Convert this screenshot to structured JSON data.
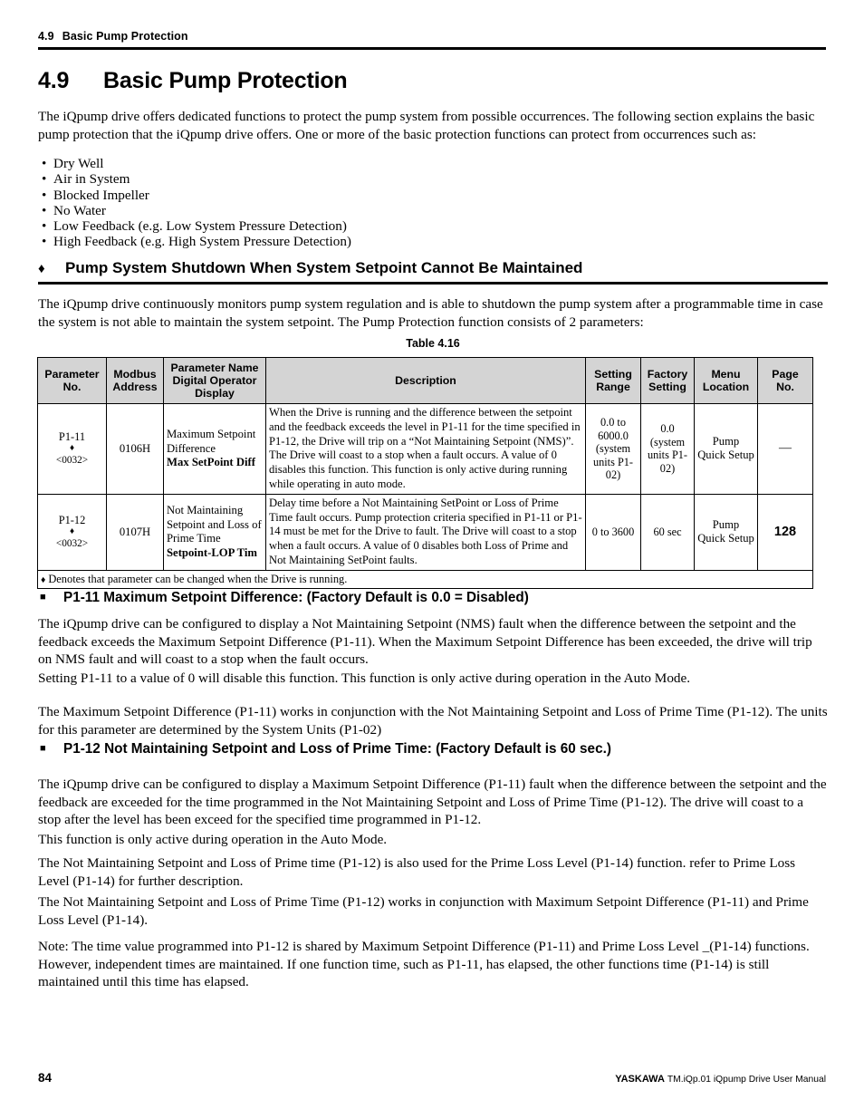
{
  "running_head": {
    "number": "4.9",
    "title": "Basic Pump Protection"
  },
  "chapter": {
    "number": "4.9",
    "title": "Basic Pump Protection"
  },
  "intro_paragraph": "The iQpump drive offers dedicated functions to protect the pump system from possible occurrences. The following section explains the basic pump protection that the iQpump drive offers. One or more of the basic protection functions can protect from occurrences such as:",
  "bullets": [
    "Dry Well",
    "Air in System",
    "Blocked Impeller",
    "No Water",
    "Low Feedback (e.g. Low System Pressure Detection)",
    "High Feedback (e.g. High System Pressure Detection)"
  ],
  "bullet_glyph": "•",
  "section": {
    "diamond_glyph": "♦",
    "heading": "Pump System Shutdown When System Setpoint Cannot Be Maintained",
    "paragraph": "The iQpump drive continuously monitors pump system regulation and is able to shutdown the pump system after a programmable time in case the system is not able to maintain the system setpoint. The Pump Protection function consists of 2 parameters:"
  },
  "table": {
    "caption": "Table 4.16",
    "headers": [
      "Parameter No.",
      "Modbus Address",
      "Parameter Name Digital Operator Display",
      "Description",
      "Setting Range",
      "Factory Setting",
      "Menu Location",
      "Page No."
    ],
    "header_lines": {
      "param_no": [
        "Parameter",
        "No."
      ],
      "modbus": [
        "Modbus",
        "Address"
      ],
      "name": [
        "Parameter Name",
        "Digital Operator",
        "Display"
      ],
      "description": [
        "Description"
      ],
      "setting_range": [
        "Setting",
        "Range"
      ],
      "factory_setting": [
        "Factory",
        "Setting"
      ],
      "menu_location": [
        "Menu",
        "Location"
      ],
      "page_no": [
        "Page",
        "No."
      ]
    },
    "rows": [
      {
        "param_no": "P1-11",
        "diamond": "♦",
        "code": "<0032>",
        "modbus": "0106H",
        "name_line1": "Maximum Setpoint",
        "name_line2": "Difference",
        "display_name": "Max SetPoint Diff",
        "description": "When the Drive is running and the difference between the setpoint and the feedback exceeds the level in P1-11 for the time specified in P1-12, the Drive will trip on a “Not Maintaining Setpoint (NMS)”. The Drive will coast to a stop when a fault occurs. A value of 0 disables this function. This function is only active during running while operating in auto mode.",
        "setting_range": "0.0 to 6000.0 (system units P1-02)",
        "factory_setting": "0.0 (system units P1-02)",
        "menu_location": "Pump Quick Setup",
        "page_no": "—"
      },
      {
        "param_no": "P1-12",
        "diamond": "♦",
        "code": "<0032>",
        "modbus": "0107H",
        "name_line1": "Not Maintaining",
        "name_line2": "Setpoint and Loss of Prime Time",
        "display_name": "Setpoint-LOP Tim",
        "description": "Delay time before a Not Maintaining SetPoint or Loss of Prime Time fault occurs. Pump protection criteria specified in P1-11 or P1-14 must be met for the Drive to fault. The Drive will coast to a stop when a fault occurs. A value of 0 disables both Loss of Prime and Not Maintaining SetPoint faults.",
        "setting_range": "0 to 3600",
        "factory_setting": "60 sec",
        "menu_location": "Pump Quick Setup",
        "page_no": "128"
      }
    ],
    "footnote": {
      "glyph": "♦",
      "text": "Denotes that parameter can be changed when the Drive is running."
    }
  },
  "subsections": [
    {
      "square_glyph": "■",
      "heading": "P1-11 Maximum Setpoint Difference: (Factory Default is 0.0 = Disabled)",
      "paragraphs": [
        "The iQpump drive can be configured to display a Not Maintaining Setpoint (NMS) fault when the difference between the setpoint and the feedback exceeds the Maximum Setpoint Difference (P1-11). When the Maximum Setpoint Difference has been exceeded, the drive will trip on NMS fault and will coast to a stop when the fault occurs.",
        "Setting P1-11 to a value of 0 will disable this function. This function is only active during operation in the Auto Mode.",
        "The Maximum Setpoint Difference (P1-11) works in conjunction with the Not Maintaining Setpoint and Loss of Prime Time (P1-12). The units for this parameter are determined by the System Units (P1-02)"
      ]
    },
    {
      "square_glyph": "■",
      "heading": "P1-12 Not Maintaining Setpoint and Loss of Prime Time: (Factory Default is 60 sec.)",
      "paragraphs": [
        "The iQpump drive can be configured to display a Maximum Setpoint Difference (P1-11) fault when the difference between the setpoint and the feedback are exceeded for the time programmed in the Not Maintaining Setpoint and Loss of Prime Time (P1-12). The drive will coast to a stop after the level has been exceed for the specified time programmed in P1-12.",
        "This function is only active during operation in the Auto Mode.",
        "The Not Maintaining Setpoint and Loss of Prime time (P1-12) is also used for the Prime Loss Level (P1-14) function. refer to Prime Loss Level (P1-14) for further description.",
        "The Not Maintaining Setpoint and Loss of Prime Time (P1-12) works in conjunction with Maximum Setpoint Difference (P1-11) and Prime Loss Level (P1-14).",
        "Note: The time value programmed into P1-12 is shared by Maximum Setpoint Difference (P1-11) and Prime Loss Level _(P1-14) functions. However, independent times are maintained. If one function time, such as P1-11, has elapsed, the other functions time (P1-14) is still maintained until this time has elapsed."
      ]
    }
  ],
  "footer": {
    "page_number": "84",
    "brand": "YASKAWA",
    "manual": "TM.iQp.01 iQpump Drive User Manual"
  }
}
